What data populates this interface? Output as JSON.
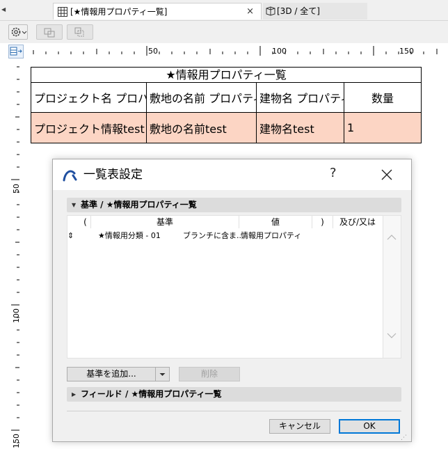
{
  "tabs": {
    "active": {
      "label": "[★情報用プロパティ一覧]",
      "close_glyph": "×"
    },
    "inactive": {
      "label": "[3D / 全て]"
    }
  },
  "ruler": {
    "h_labels": [
      "50",
      "100",
      "150"
    ],
    "v_labels": [
      "50",
      "100",
      "150"
    ]
  },
  "schedule": {
    "title": "★情報用プロパティ一覧",
    "headers": [
      "プロジェクト名 プロパティ",
      "敷地の名前 プロパティ",
      "建物名 プロパティ",
      "数量"
    ],
    "row": [
      "プロジェクト情報test",
      "敷地の名前test",
      "建物名test",
      "1"
    ],
    "row_color": "#fcd5c4"
  },
  "dialog": {
    "title": "一覧表設定",
    "help": "?",
    "criteria_section": "基準 /  ★情報用プロパティ一覧",
    "columns": [
      "(",
      "基準",
      "値",
      ")",
      "及び/又は"
    ],
    "criteria_row": {
      "sort_glyph": "⇕",
      "criterion": "★情報用分類 - 01",
      "operator": "ブランチに含ま...",
      "value": "情報用プロパティ"
    },
    "add_criterion": "基準を追加...",
    "delete": "削除",
    "fields_section": "フィールド /  ★情報用プロパティ一覧",
    "cancel": "キャンセル",
    "ok": "OK",
    "accent_color": "#0078d7"
  }
}
